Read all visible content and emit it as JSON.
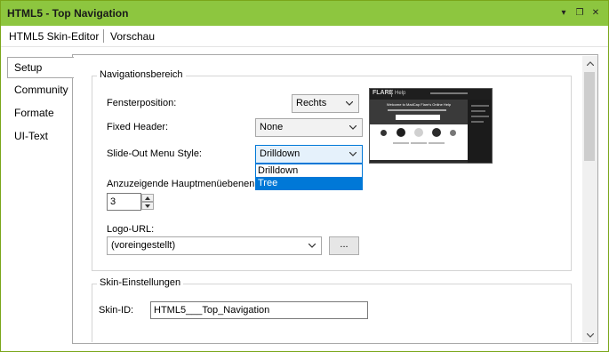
{
  "window": {
    "title": "HTML5 - Top Navigation",
    "controls": {
      "pin": "▾",
      "restore": "❐",
      "close": "✕"
    }
  },
  "toolbar": {
    "editor_label": "HTML5 Skin-Editor",
    "preview_label": "Vorschau"
  },
  "sidebar": {
    "tabs": [
      {
        "label": "Setup",
        "active": true
      },
      {
        "label": "Community"
      },
      {
        "label": "Formate"
      },
      {
        "label": "UI-Text"
      }
    ]
  },
  "navigation": {
    "legend": "Navigationsbereich",
    "window_position": {
      "label": "Fensterposition:",
      "value": "Rechts"
    },
    "fixed_header": {
      "label": "Fixed Header:",
      "value": "None"
    },
    "slide_out": {
      "label": "Slide-Out Menu Style:",
      "value": "Drilldown",
      "options": [
        {
          "label": "Drilldown"
        },
        {
          "label": "Tree",
          "highlighted": true
        }
      ]
    },
    "main_menu_levels": {
      "label": "Anzuzeigende Hauptmenüebenen (",
      "value": "3"
    },
    "logo_url": {
      "label": "Logo-URL:",
      "value": "(voreingestellt)",
      "browse_label": "..."
    }
  },
  "preview": {
    "brand": "FLARE",
    "nav": "Help",
    "welcome": "Welcome to MadCap Flare's Online Help"
  },
  "skin": {
    "legend": "Skin-Einstellungen",
    "id_label": "Skin-ID:",
    "id_value": "HTML5___Top_Navigation"
  },
  "colors": {
    "titlebar": "#8dc63f",
    "accent": "#0078d7",
    "preview_bg": "#2b2b2b"
  }
}
